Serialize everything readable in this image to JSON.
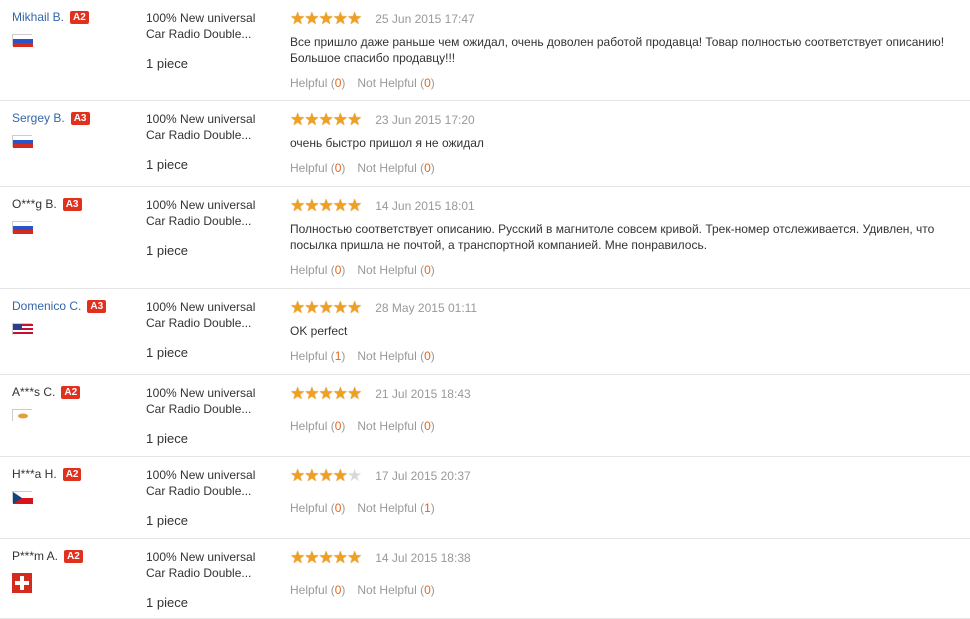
{
  "reviews": [
    {
      "name": "Mikhail B.",
      "link": true,
      "level": "A2",
      "flag": "ru",
      "product": [
        "100% New universal",
        "Car Radio Double..."
      ],
      "qty": "1 piece",
      "stars": 5,
      "date": "25 Jun 2015 17:47",
      "text": "Все пришло даже раньше чем ожидал, очень доволен работой продавца! Товар полностью соответствует описанию! Большое спасибо продавцу!!!",
      "helpful": "0",
      "not_helpful": "0"
    },
    {
      "name": "Sergey B.",
      "link": true,
      "level": "A3",
      "flag": "ru",
      "product": [
        "100% New universal",
        "Car Radio Double..."
      ],
      "qty": "1 piece",
      "stars": 5,
      "date": "23 Jun 2015 17:20",
      "text": "очень быстро пришол я не ожидал",
      "helpful": "0",
      "not_helpful": "0"
    },
    {
      "name": "O***g B.",
      "link": false,
      "level": "A3",
      "flag": "ru",
      "product": [
        "100% New universal",
        "Car Radio Double..."
      ],
      "qty": "1 piece",
      "stars": 5,
      "date": "14 Jun 2015 18:01",
      "text": "Полностью соответствует описанию. Русский в магнитоле совсем кривой. Трек-номер отслеживается. Удивлен, что посылка пришла не почтой, а транспортной компанией. Мне понравилось.",
      "helpful": "0",
      "not_helpful": "0"
    },
    {
      "name": "Domenico C.",
      "link": true,
      "level": "A3",
      "flag": "us",
      "product": [
        "100% New universal",
        "Car Radio Double..."
      ],
      "qty": "1 piece",
      "stars": 5,
      "date": "28 May 2015 01:11",
      "text": "OK perfect",
      "helpful": "1",
      "not_helpful": "0"
    },
    {
      "name": "A***s C.",
      "link": false,
      "level": "A2",
      "flag": "cy",
      "product": [
        "100% New universal",
        "Car Radio Double..."
      ],
      "qty": "1 piece",
      "stars": 5,
      "date": "21 Jul 2015 18:43",
      "text": "",
      "helpful": "0",
      "not_helpful": "0"
    },
    {
      "name": "H***a H.",
      "link": false,
      "level": "A2",
      "flag": "cz",
      "product": [
        "100% New universal",
        "Car Radio Double..."
      ],
      "qty": "1 piece",
      "stars": 4,
      "date": "17 Jul 2015 20:37",
      "text": "",
      "helpful": "0",
      "not_helpful": "1"
    },
    {
      "name": "P***m A.",
      "link": false,
      "level": "A2",
      "flag": "ch",
      "product": [
        "100% New universal",
        "Car Radio Double..."
      ],
      "qty": "1 piece",
      "stars": 5,
      "date": "14 Jul 2015 18:38",
      "text": "",
      "helpful": "0",
      "not_helpful": "0"
    }
  ],
  "labels": {
    "helpful": "Helpful",
    "not_helpful": "Not Helpful"
  },
  "colors": {
    "link": "#3366aa",
    "badge": "#e0301e",
    "star": "#f0a020",
    "count": "#e06820"
  }
}
